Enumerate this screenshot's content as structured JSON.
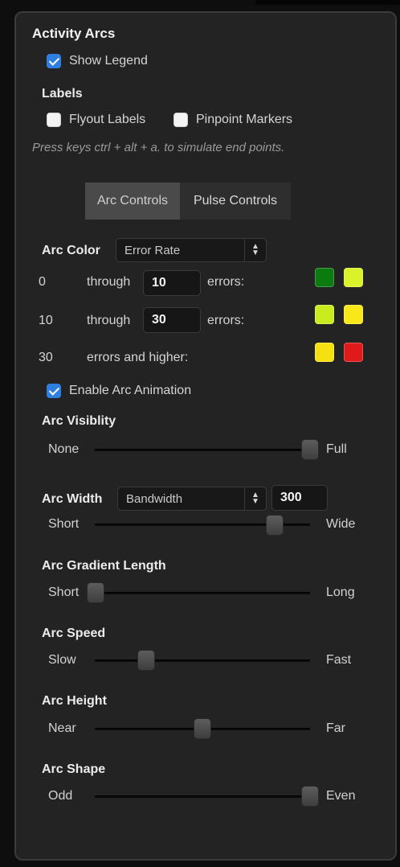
{
  "panel": {
    "title": "Activity Arcs",
    "show_legend": {
      "label": "Show Legend",
      "checked": true
    },
    "labels_heading": "Labels",
    "flyout_labels": {
      "label": "Flyout Labels",
      "checked": false
    },
    "pinpoint_markers": {
      "label": "Pinpoint Markers",
      "checked": false
    },
    "hint": "Press keys ctrl + alt + a. to simulate end points."
  },
  "tabs": [
    {
      "label": "Arc Controls",
      "active": true
    },
    {
      "label": "Pulse Controls",
      "active": false
    }
  ],
  "arc_color": {
    "label": "Arc Color",
    "select_value": "Error Rate",
    "rows": [
      {
        "from": "0",
        "word": "through",
        "value": "10",
        "suffix": "errors:",
        "colors": [
          "#0d7a10",
          "#d9f22a"
        ]
      },
      {
        "from": "10",
        "word": "through",
        "value": "30",
        "suffix": "errors:",
        "colors": [
          "#c8ec1e",
          "#f8e81a"
        ]
      },
      {
        "from": "30",
        "text": "errors and higher:",
        "colors": [
          "#f5e012",
          "#e01a1a"
        ]
      }
    ]
  },
  "enable_animation": {
    "label": "Enable Arc Animation",
    "checked": true
  },
  "arc_visibility": {
    "label": "Arc Visiblity",
    "min": "None",
    "max": "Full",
    "level": 1.0
  },
  "arc_width": {
    "label": "Arc Width",
    "select_value": "Bandwidth",
    "value": "300",
    "min": "Short",
    "max": "Wide",
    "level": 0.84
  },
  "arc_gradient_length": {
    "label": "Arc Gradient Length",
    "min": "Short",
    "max": "Long",
    "level": 0.0
  },
  "arc_speed": {
    "label": "Arc Speed",
    "min": "Slow",
    "max": "Fast",
    "level": 0.24
  },
  "arc_height": {
    "label": "Arc Height",
    "min": "Near",
    "max": "Far",
    "level": 0.5
  },
  "arc_shape": {
    "label": "Arc Shape",
    "min": "Odd",
    "max": "Even",
    "level": 1.0
  }
}
